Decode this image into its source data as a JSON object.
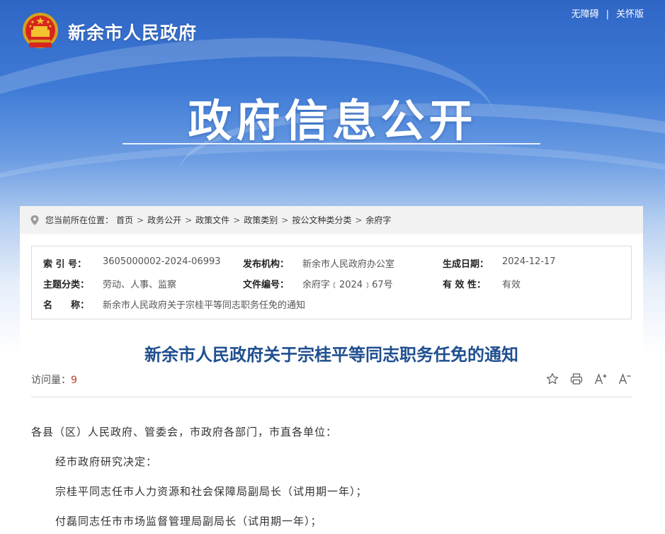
{
  "header": {
    "site_name": "新余市人民政府",
    "accessibility_link": "无障碍",
    "separator": "|",
    "care_mode_link": "关怀版",
    "banner_title": "政府信息公开"
  },
  "breadcrumb": {
    "prefix": "您当前所在位置：",
    "items": [
      "首页",
      "政务公开",
      "政策文件",
      "政策类别",
      "按公文种类分类",
      "余府字"
    ],
    "separator": ">"
  },
  "meta": {
    "index_label": "索 引 号：",
    "index_value": "3605000002-2024-06993",
    "publisher_label": "发布机构：",
    "publisher_value": "新余市人民政府办公室",
    "date_label": "生成日期：",
    "date_value": "2024-12-17",
    "topic_label": "主题分类：",
    "topic_value": "劳动、人事、监察",
    "docno_label": "文件编号：",
    "docno_value": "余府字﹝2024﹞67号",
    "validity_label": "有 效 性：",
    "validity_value": "有效",
    "name_label": "名　　称：",
    "name_value": "新余市人民政府关于宗桂平等同志职务任免的通知"
  },
  "article": {
    "title": "新余市人民政府关于宗桂平等同志职务任免的通知",
    "visits_label": "访问量：",
    "visits_count": "9",
    "paragraphs": [
      "各县（区）人民政府、管委会，市政府各部门，市直各单位：",
      "经市政府研究决定：",
      "宗桂平同志任市人力资源和社会保障局副局长（试用期一年）；",
      "付磊同志任市市场监督管理局副局长（试用期一年）；"
    ]
  },
  "icons": {
    "emblem": "national-emblem-icon",
    "pin": "location-pin-icon",
    "star": "star-icon",
    "print": "print-icon",
    "font_up": "font-increase-icon",
    "font_down": "font-decrease-icon"
  },
  "colors": {
    "banner_blue": "#2f66c6",
    "title_blue": "#1f4f8f",
    "count_red": "#c0392b"
  }
}
